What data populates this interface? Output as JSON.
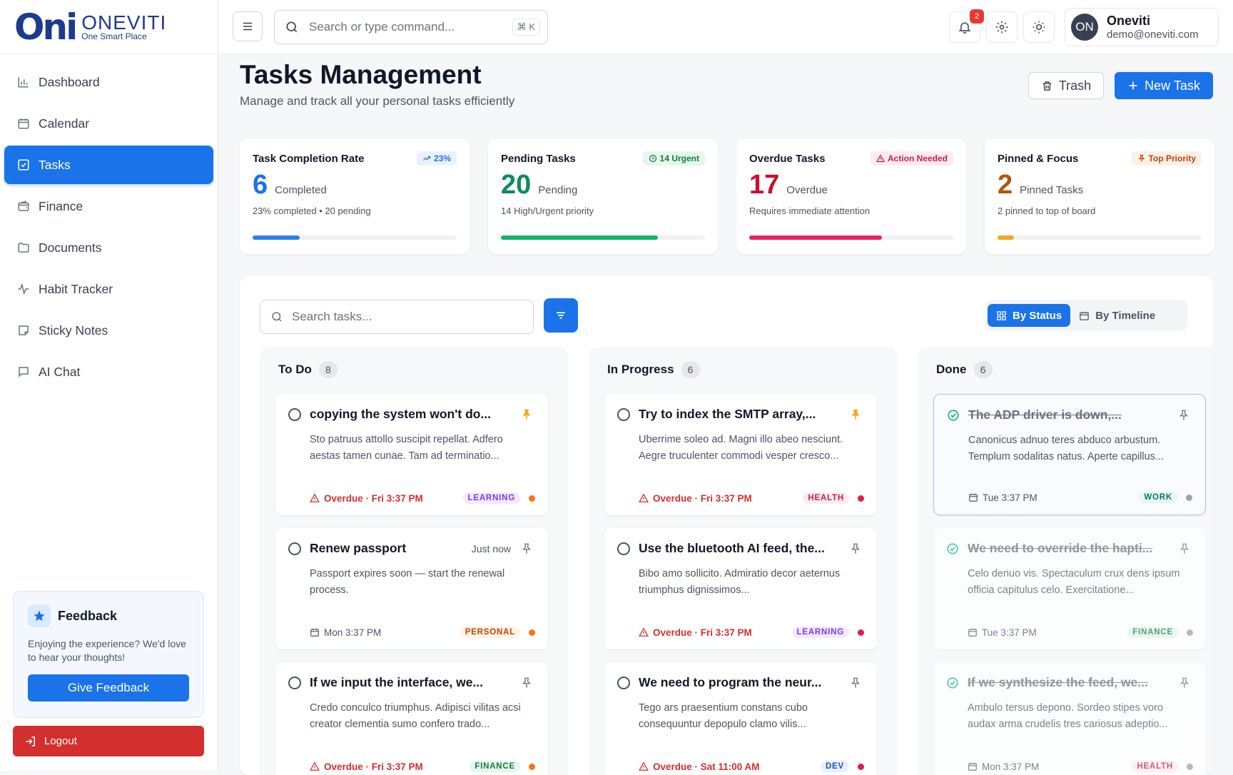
{
  "brand": {
    "mark": "Oni",
    "name": "ONEVITI",
    "tagline": "One Smart Place"
  },
  "sidebar": {
    "items": [
      {
        "label": "Dashboard",
        "icon": "bar-chart-icon"
      },
      {
        "label": "Calendar",
        "icon": "calendar-icon"
      },
      {
        "label": "Tasks",
        "icon": "checkbox-icon",
        "active": true
      },
      {
        "label": "Finance",
        "icon": "wallet-icon"
      },
      {
        "label": "Documents",
        "icon": "folder-icon"
      },
      {
        "label": "Habit Tracker",
        "icon": "activity-icon"
      },
      {
        "label": "Sticky Notes",
        "icon": "note-icon"
      },
      {
        "label": "AI Chat",
        "icon": "chat-icon"
      }
    ],
    "feedback": {
      "title": "Feedback",
      "text": "Enjoying the experience? We'd love to hear your thoughts!",
      "button": "Give Feedback"
    },
    "logout": "Logout"
  },
  "topbar": {
    "search_placeholder": "Search or type command...",
    "shortcut": "⌘ K",
    "notifications": "2",
    "user": {
      "initials": "ON",
      "name": "Oneviti",
      "email": "demo@oneviti.com"
    }
  },
  "page": {
    "title": "Tasks Management",
    "subtitle": "Manage and track all your personal tasks efficiently",
    "trash_label": "Trash",
    "new_task_label": "New Task"
  },
  "stats": [
    {
      "title": "Task Completion Rate",
      "pill": "23%",
      "num": "6",
      "unit": "Completed",
      "desc": "23% completed • 20 pending",
      "progress": 0.23,
      "color": "#2f80ed",
      "pill_bg": "#eaf2fd",
      "pill_fg": "#2f6fd6"
    },
    {
      "title": "Pending Tasks",
      "pill": "14 Urgent",
      "num": "20",
      "unit": "Pending",
      "desc": "14 High/Urgent priority",
      "progress": 0.77,
      "color": "#16b36e",
      "pill_bg": "#e6f6ee",
      "pill_fg": "#15803d"
    },
    {
      "title": "Overdue Tasks",
      "pill": "Action Needed",
      "num": "17",
      "unit": "Overdue",
      "desc": "Requires immediate attention",
      "progress": 0.65,
      "color": "#e8245f",
      "pill_bg": "#fdecef",
      "pill_fg": "#c81e4a"
    },
    {
      "title": "Pinned & Focus",
      "pill": "Top Priority",
      "num": "2",
      "unit": "Pinned Tasks",
      "desc": "2 pinned to top of board",
      "progress": 0.08,
      "color": "#f5a623",
      "pill_bg": "#fdf1e4",
      "pill_fg": "#c2410c"
    }
  ],
  "board": {
    "search_placeholder": "Search tasks...",
    "views": [
      "By Status",
      "By Timeline"
    ],
    "columns": [
      {
        "title": "To Do",
        "count": "8",
        "cards": [
          {
            "title": "copying the system won't do...",
            "desc": "Sto patruus attollo suscipit repellat. Adfero aestas tamen cunae. Tam ad terminatio...",
            "due": "Overdue · Fri 3:37 PM",
            "overdue": true,
            "tag": "LEARNING",
            "tag_bg": "#f3e8fd",
            "tag_fg": "#7c3aed",
            "dot": "#f97316",
            "pinned": true,
            "when": ""
          },
          {
            "title": "Renew passport",
            "desc": "Passport expires soon — start the renewal process.",
            "due": "Mon 3:37 PM",
            "overdue": false,
            "tag": "PERSONAL",
            "tag_bg": "#fef3e2",
            "tag_fg": "#c2410c",
            "dot": "#f97316",
            "pinned": false,
            "when": "Just now"
          },
          {
            "title": "If we input the interface, we...",
            "desc": "Credo conculco triumphus. Adipisci vilitas acsi creator clementia sumo confero trado...",
            "due": "Overdue · Fri 3:37 PM",
            "overdue": true,
            "tag": "FINANCE",
            "tag_bg": "#e6f7ee",
            "tag_fg": "#15803d",
            "dot": "#f97316",
            "pinned": false,
            "when": ""
          }
        ]
      },
      {
        "title": "In Progress",
        "count": "6",
        "cards": [
          {
            "title": "Try to index the SMTP array,...",
            "desc": "Uberrime soleo ad. Magni illo abeo nesciunt. Aegre truculenter commodi vesper cresco...",
            "due": "Overdue · Fri 3:37 PM",
            "overdue": true,
            "tag": "HEALTH",
            "tag_bg": "#fdecef",
            "tag_fg": "#c81e4a",
            "dot": "#e11d48",
            "pinned": true,
            "when": ""
          },
          {
            "title": "Use the bluetooth AI feed, the...",
            "desc": "Bibo amo sollicito. Admiratio decor aeternus triumphus dignissimos...",
            "due": "Overdue · Fri 3:37 PM",
            "overdue": true,
            "tag": "LEARNING",
            "tag_bg": "#f3e8fd",
            "tag_fg": "#7c3aed",
            "dot": "#e11d48",
            "pinned": false,
            "when": ""
          },
          {
            "title": "We need to program the neur...",
            "desc": "Tego ars praesentium constans cubo consequuntur depopulo clamo vilis...",
            "due": "Overdue · Sat 11:00 AM",
            "overdue": true,
            "tag": "DEV",
            "tag_bg": "#e8f0fe",
            "tag_fg": "#1d4ed8",
            "dot": "#e11d48",
            "pinned": false,
            "when": ""
          }
        ]
      },
      {
        "title": "Done",
        "count": "6",
        "cards": [
          {
            "title": "The ADP driver is down,...",
            "desc": "Canonicus adnuo teres abduco arbustum. Templum sodalitas natus. Aperte capillus...",
            "due": "Tue 3:37 PM",
            "overdue": false,
            "tag": "WORK",
            "tag_bg": "#e6f6f3",
            "tag_fg": "#0f766e",
            "dot": "#9ca3af",
            "pinned": false,
            "when": ""
          },
          {
            "title": "We need to override the hapti...",
            "desc": "Celo denuo vis. Spectaculum crux dens ipsum officia capitulus celo. Exercitatione...",
            "due": "Tue 3:37 PM",
            "overdue": false,
            "tag": "FINANCE",
            "tag_bg": "#e6f7ee",
            "tag_fg": "#15803d",
            "dot": "#9ca3af",
            "pinned": false,
            "when": ""
          },
          {
            "title": "If we synthesize the feed, we...",
            "desc": "Ambulo tersus depono. Sordeo stipes voro audax arma crudelis tres cariosus adeptio...",
            "due": "Mon 3:37 PM",
            "overdue": false,
            "tag": "HEALTH",
            "tag_bg": "#fdecef",
            "tag_fg": "#c81e4a",
            "dot": "#9ca3af",
            "pinned": false,
            "when": ""
          }
        ]
      }
    ]
  }
}
